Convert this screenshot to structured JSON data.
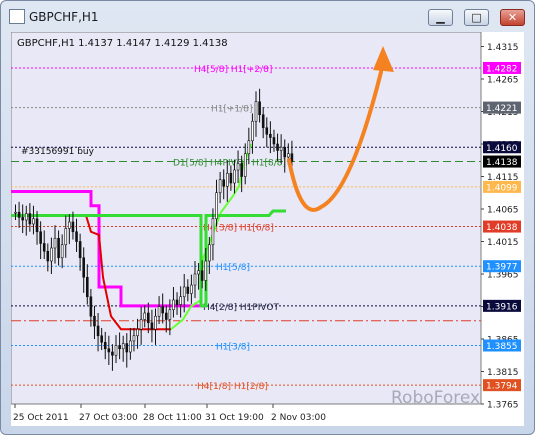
{
  "window": {
    "title": "GBPCHF,H1",
    "buttons": {
      "minimize": "▁",
      "maximize": "□",
      "close": "✕"
    }
  },
  "chart_data": {
    "type": "candlestick",
    "symbol_line": "GBPCHF,H1  1.4137 1.4147 1.4129 1.4138",
    "ylim": [
      1.3765,
      1.4325
    ],
    "y_ticks": [
      "1.4315",
      "1.4265",
      "1.4215",
      "1.4165",
      "1.4115",
      "1.4065",
      "1.4015",
      "1.3965",
      "1.3915",
      "1.3865",
      "1.3815",
      "1.3765"
    ],
    "x_ticks": [
      "25 Oct 2011",
      "27 Oct 03:00",
      "28 Oct 11:00",
      "31 Oct 19:00",
      "2 Nov 03:00"
    ],
    "price_labels": [
      {
        "text": "1.4282",
        "color": "#ff00ff"
      },
      {
        "text": "1.4221",
        "color": "#5e6470"
      },
      {
        "text": "1.4160",
        "color": "#0a0a3c"
      },
      {
        "text": "1.4138",
        "color": "#000000"
      },
      {
        "text": "1.4099",
        "color": "#ffb84d"
      },
      {
        "text": "1.4038",
        "color": "#e03c28"
      },
      {
        "text": "1.3977",
        "color": "#1e90ff"
      },
      {
        "text": "1.3916",
        "color": "#0a0a3c"
      },
      {
        "text": "1.3855",
        "color": "#1e90ff"
      },
      {
        "text": "1.3794",
        "color": "#e05020"
      }
    ],
    "levels": [
      {
        "price": 1.4282,
        "color": "#ff00ff",
        "label": "H4[5/8] H1[+2/8]"
      },
      {
        "price": 1.4221,
        "color": "#8a8a8a",
        "label": "H1[+1/8]"
      },
      {
        "price": 1.416,
        "color": "#0a0a3c",
        "label": ""
      },
      {
        "price": 1.4138,
        "color": "#2e8b2e",
        "label": "D1[5/8] H4PIVOT H1[8/8]"
      },
      {
        "price": 1.4099,
        "color": "#ffb84d",
        "label": ""
      },
      {
        "price": 1.4038,
        "color": "#e03c28",
        "label": "H4[3/8] H1[6/8]"
      },
      {
        "price": 1.3977,
        "color": "#1e90ff",
        "label": "H1[5/8]"
      },
      {
        "price": 1.3916,
        "color": "#0a0a3c",
        "label": "H4[2/8] H1PIVOT"
      },
      {
        "price": 1.3893,
        "color": "#e03c28",
        "label": ""
      },
      {
        "price": 1.3855,
        "color": "#1e90ff",
        "label": "H1[3/8]"
      },
      {
        "price": 1.3794,
        "color": "#e05020",
        "label": "H4[1/8] H1[2/8]"
      }
    ],
    "order_label": "#33156991 buy",
    "watermark": "RoboForex",
    "close_series": [
      1.406,
      1.4052,
      1.4048,
      1.4058,
      1.4042,
      1.405,
      1.403,
      1.4012,
      1.4,
      1.3985,
      1.4005,
      1.402,
      1.399,
      1.401,
      1.4035,
      1.4045,
      1.403,
      1.4015,
      1.399,
      1.396,
      1.393,
      1.39,
      1.3885,
      1.387,
      1.386,
      1.385,
      1.3845,
      1.384,
      1.3855,
      1.385,
      1.3858,
      1.3845,
      1.3862,
      1.387,
      1.388,
      1.3895,
      1.3905,
      1.389,
      1.388,
      1.39,
      1.3915,
      1.3905,
      1.3895,
      1.391,
      1.3925,
      1.3918,
      1.393,
      1.3945,
      1.3935,
      1.3948,
      1.3965,
      1.397,
      1.3955,
      1.3985,
      1.401,
      1.405,
      1.409,
      1.411,
      1.41,
      1.412,
      1.4105,
      1.4125,
      1.4135,
      1.4115,
      1.415,
      1.417,
      1.42,
      1.423,
      1.421,
      1.419,
      1.418,
      1.4175,
      1.4165,
      1.4155,
      1.416,
      1.4145,
      1.415,
      1.4138
    ]
  }
}
